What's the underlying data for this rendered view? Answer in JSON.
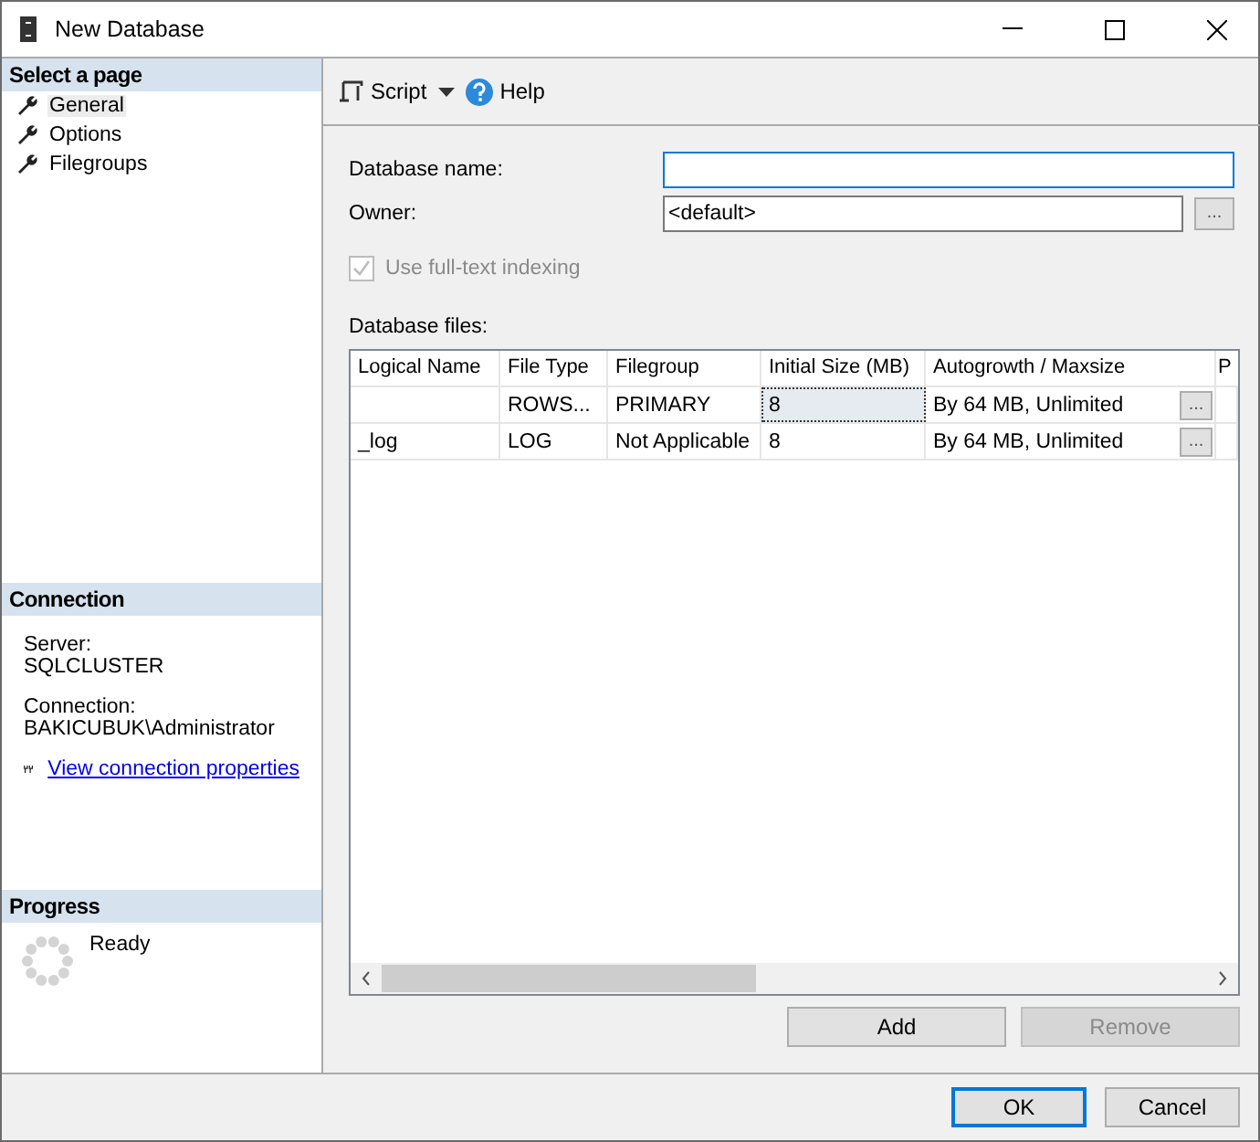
{
  "window": {
    "title": "New Database"
  },
  "select_page": {
    "title": "Select a page",
    "items": [
      {
        "label": "General",
        "selected": true
      },
      {
        "label": "Options",
        "selected": false
      },
      {
        "label": "Filegroups",
        "selected": false
      }
    ]
  },
  "connection": {
    "title": "Connection",
    "server_label": "Server:",
    "server": "SQLCLUSTER",
    "connection_label": "Connection:",
    "connection": "BAKICUBUK\\Administrator",
    "link": "View connection properties"
  },
  "progress": {
    "title": "Progress",
    "status": "Ready"
  },
  "toolbar": {
    "script": "Script",
    "help": "Help"
  },
  "form": {
    "name_label": "Database name:",
    "owner_label": "Owner:",
    "owner_value": "<default>",
    "browse": "...",
    "fulltext": {
      "label": "Use full-text indexing",
      "checked": true,
      "disabled": true
    }
  },
  "files": {
    "title": "Database files:",
    "columns": [
      "Logical Name",
      "File Type",
      "Filegroup",
      "Initial Size (MB)",
      "Autogrowth / Maxsize",
      "P"
    ],
    "rows": [
      {
        "cells": [
          "",
          "ROWS...",
          "PRIMARY",
          "8",
          "By 64 MB, Unlimited"
        ],
        "browse": "...",
        "focused": [
          false,
          false,
          false,
          true,
          false
        ]
      },
      {
        "cells": [
          "_log",
          "LOG",
          "Not Applicable",
          "8",
          "By 64 MB, Unlimited"
        ],
        "browse": "...",
        "focused": [
          false,
          false,
          false,
          false,
          false
        ]
      }
    ],
    "buttons": [
      {
        "label": "Add",
        "disabled": false
      },
      {
        "label": "Remove",
        "disabled": true
      }
    ]
  },
  "footer": [
    {
      "label": "OK",
      "default": true
    },
    {
      "label": "Cancel",
      "default": false
    }
  ]
}
